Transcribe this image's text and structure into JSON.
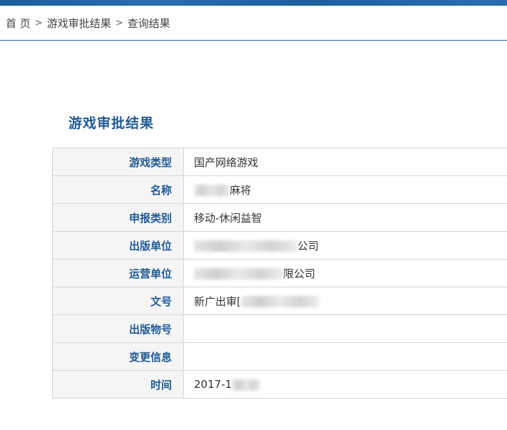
{
  "breadcrumb": {
    "home": "首 页",
    "section": "游戏审批结果",
    "current": "查询结果",
    "separator": ">"
  },
  "page": {
    "title": "游戏审批结果"
  },
  "rows": [
    {
      "label": "游戏类型",
      "value": "国产网络游戏"
    },
    {
      "label": "名称",
      "value_prefix": "",
      "value_suffix": "麻将"
    },
    {
      "label": "申报类别",
      "value": "移动-休闲益智"
    },
    {
      "label": "出版单位",
      "value_prefix": "",
      "value_suffix": "公司"
    },
    {
      "label": "运营单位",
      "value_prefix": "",
      "value_suffix": "限公司"
    },
    {
      "label": "文号",
      "value_prefix": "新广出审[",
      "value_suffix": ""
    },
    {
      "label": "出版物号",
      "value": ""
    },
    {
      "label": "变更信息",
      "value": ""
    },
    {
      "label": "时间",
      "value_prefix": "2017-1",
      "value_suffix": ""
    }
  ],
  "colors": {
    "accent": "#1f5a95",
    "label_bg": "#f5f5f5",
    "border": "#d6d6d6"
  }
}
